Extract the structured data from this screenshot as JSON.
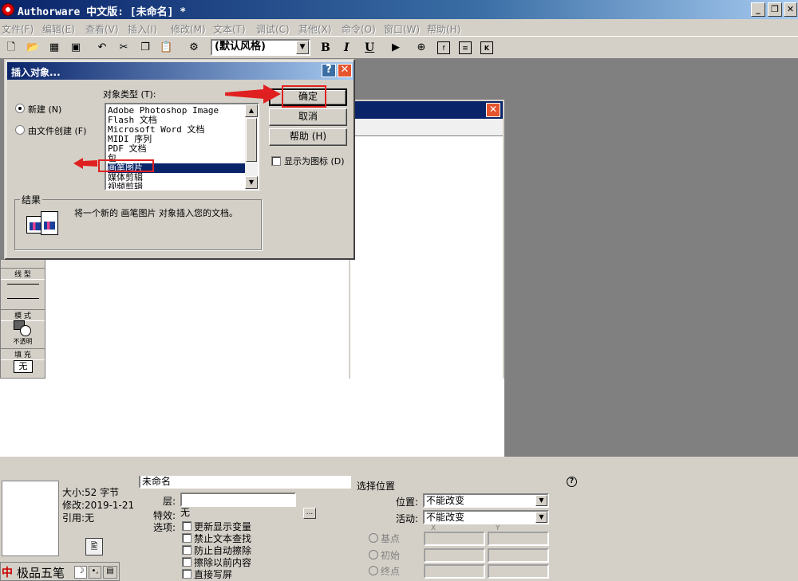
{
  "app": {
    "title": "Authorware 中文版: [未命名] *",
    "minimize": "_",
    "restore": "❐",
    "close": "✕"
  },
  "menu": [
    "文件(F)",
    "编辑(E)",
    "查看(V)",
    "插入(I)",
    "修改(M)",
    "文本(T)",
    "调试(C)",
    "其他(X)",
    "命令(O)",
    "窗口(W)",
    "帮助(H)"
  ],
  "toolbar": {
    "style_value": "(默认风格)",
    "bold": "B",
    "italic": "I",
    "underline": "U"
  },
  "palette": {
    "line_label": "线 型",
    "mode_label": "模 式",
    "mode_value": "不透明",
    "fill_label": "填 充",
    "fill_value": "无"
  },
  "dialog": {
    "title": "插入对象...",
    "help_glyph": "?",
    "close_glyph": "✕",
    "radio_new": "新建 (N)",
    "radio_from_file": "由文件创建 (F)",
    "type_label": "对象类型 (T):",
    "object_types": [
      "Adobe Photoshop Image",
      "Flash 文档",
      "Microsoft Word 文档",
      "MIDI 序列",
      "PDF 文档",
      "包",
      "画笔图片",
      "媒体剪辑",
      "视频剪辑"
    ],
    "selected_type": "画笔图片",
    "ok_button": "确定",
    "cancel_button": "取消",
    "help_button": "帮助 (H)",
    "display_as_icon": "显示为图标 (D)",
    "result_label": "结果",
    "result_text": "将一个新的 画笔图片 对象插入您的文档。"
  },
  "props": {
    "size": "大小:52 字节",
    "modified": "修改:2019-1-21",
    "reference": "引用:无",
    "name_partial": "未命名",
    "layer_label": "层:",
    "effect_label": "特效:",
    "effect_value": "无",
    "effect_btn": "...",
    "options_label": "选项:",
    "options": [
      "更新显示变量",
      "禁止文本查找",
      "防止自动擦除",
      "擦除以前内容",
      "直接写屏"
    ],
    "select_position": "选择位置",
    "position_label": "位置:",
    "position_value": "不能改变",
    "activity_label": "活动:",
    "activity_value": "不能改变",
    "x_header": "X",
    "y_header": "Y",
    "base_point": "基点",
    "initial": "初始",
    "end_point": "终点",
    "help_icon": "?"
  },
  "ime": {
    "label": "极品五笔",
    "logo": "中"
  },
  "colors": {
    "title_blue": "#0a246a",
    "selection": "#0a246a",
    "annotation_red": "#e02020",
    "window_gray": "#d4d0c8"
  }
}
